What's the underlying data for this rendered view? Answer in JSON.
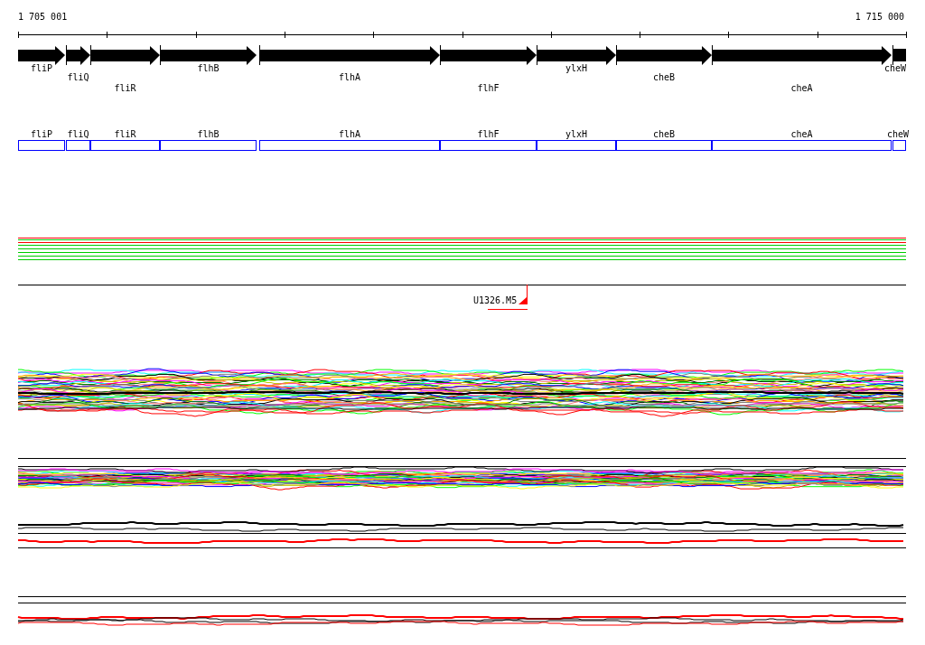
{
  "ruler": {
    "start_label": "1 705 001",
    "end_label": "1 715 000"
  },
  "gene_arrows": [
    {
      "name": "fliP"
    },
    {
      "name": "fliQ"
    },
    {
      "name": "fliR"
    },
    {
      "name": "flhB"
    },
    {
      "name": "flhA"
    },
    {
      "name": "flhF"
    },
    {
      "name": "ylxH"
    },
    {
      "name": "cheB"
    },
    {
      "name": "cheA"
    },
    {
      "name": "cheW"
    }
  ],
  "gene_boxes": [
    {
      "name": "fliP"
    },
    {
      "name": "fliQ"
    },
    {
      "name": "fliR"
    },
    {
      "name": "flhB"
    },
    {
      "name": "flhA"
    },
    {
      "name": "flhF"
    },
    {
      "name": "ylxH"
    },
    {
      "name": "cheB"
    },
    {
      "name": "cheA"
    },
    {
      "name": "cheW"
    }
  ],
  "marker": {
    "label": "U1326.M5"
  }
}
